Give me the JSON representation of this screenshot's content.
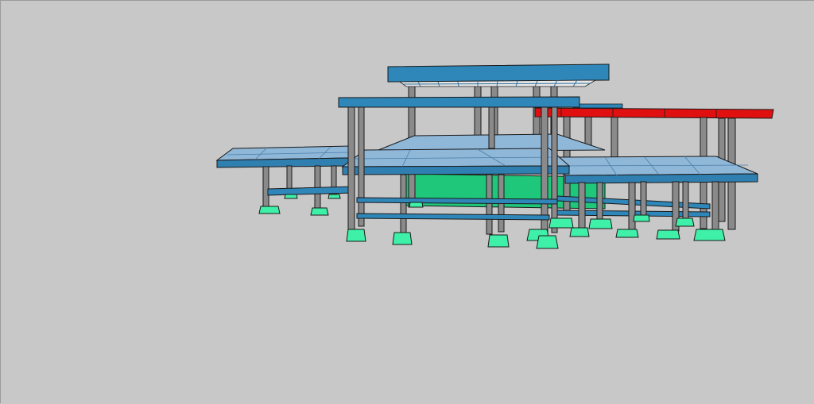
{
  "scene": {
    "background": "#c8c8c8",
    "colors": {
      "slab_top": "#8fb7d8",
      "slab_edge": "#2f7fb0",
      "beam": "#2f86b8",
      "roof": "#2f86b8",
      "roof_red": "#e01010",
      "column": "#8a8a8a",
      "footing": "#3ff0a8",
      "ground_slab": "#1fc77a",
      "outline": "#1a1a1a"
    },
    "structure": {
      "front_columns": 12,
      "footings": 18,
      "roof_levels": 3
    }
  }
}
